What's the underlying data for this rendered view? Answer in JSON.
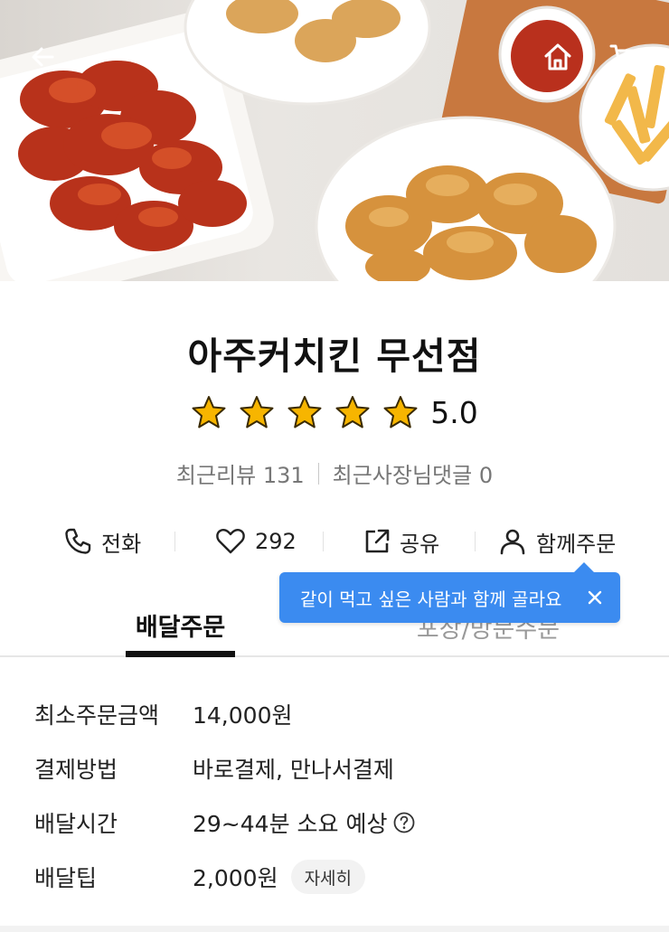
{
  "hero": {
    "back_icon": "arrow-left-icon",
    "home_icon": "home-icon",
    "cart_icon": "cart-icon"
  },
  "store": {
    "name": "아주커치킨 무선점",
    "rating_value": 5.0,
    "rating_text": "5.0",
    "stars_filled": 5,
    "star_color": "#f7b500",
    "recent_reviews": "최근리뷰 131",
    "recent_owner_comments": "최근사장님댓글 0"
  },
  "actions": {
    "call_label": "전화",
    "like_count": "292",
    "share_label": "공유",
    "group_order_label": "함께주문"
  },
  "tooltip": {
    "text": "같이 먹고 싶은 사람과 함께 골라요",
    "color": "#3b8bf0"
  },
  "tabs": {
    "delivery": "배달주문",
    "pickup": "포장/방문주문"
  },
  "info": {
    "min_order_label": "최소주문금액",
    "min_order_value": "14,000원",
    "payment_label": "결제방법",
    "payment_value": "바로결제, 만나서결제",
    "delivery_time_label": "배달시간",
    "delivery_time_value": "29~44분 소요 예상",
    "delivery_tip_label": "배달팁",
    "delivery_tip_value": "2,000원",
    "detail_button": "자세히"
  }
}
